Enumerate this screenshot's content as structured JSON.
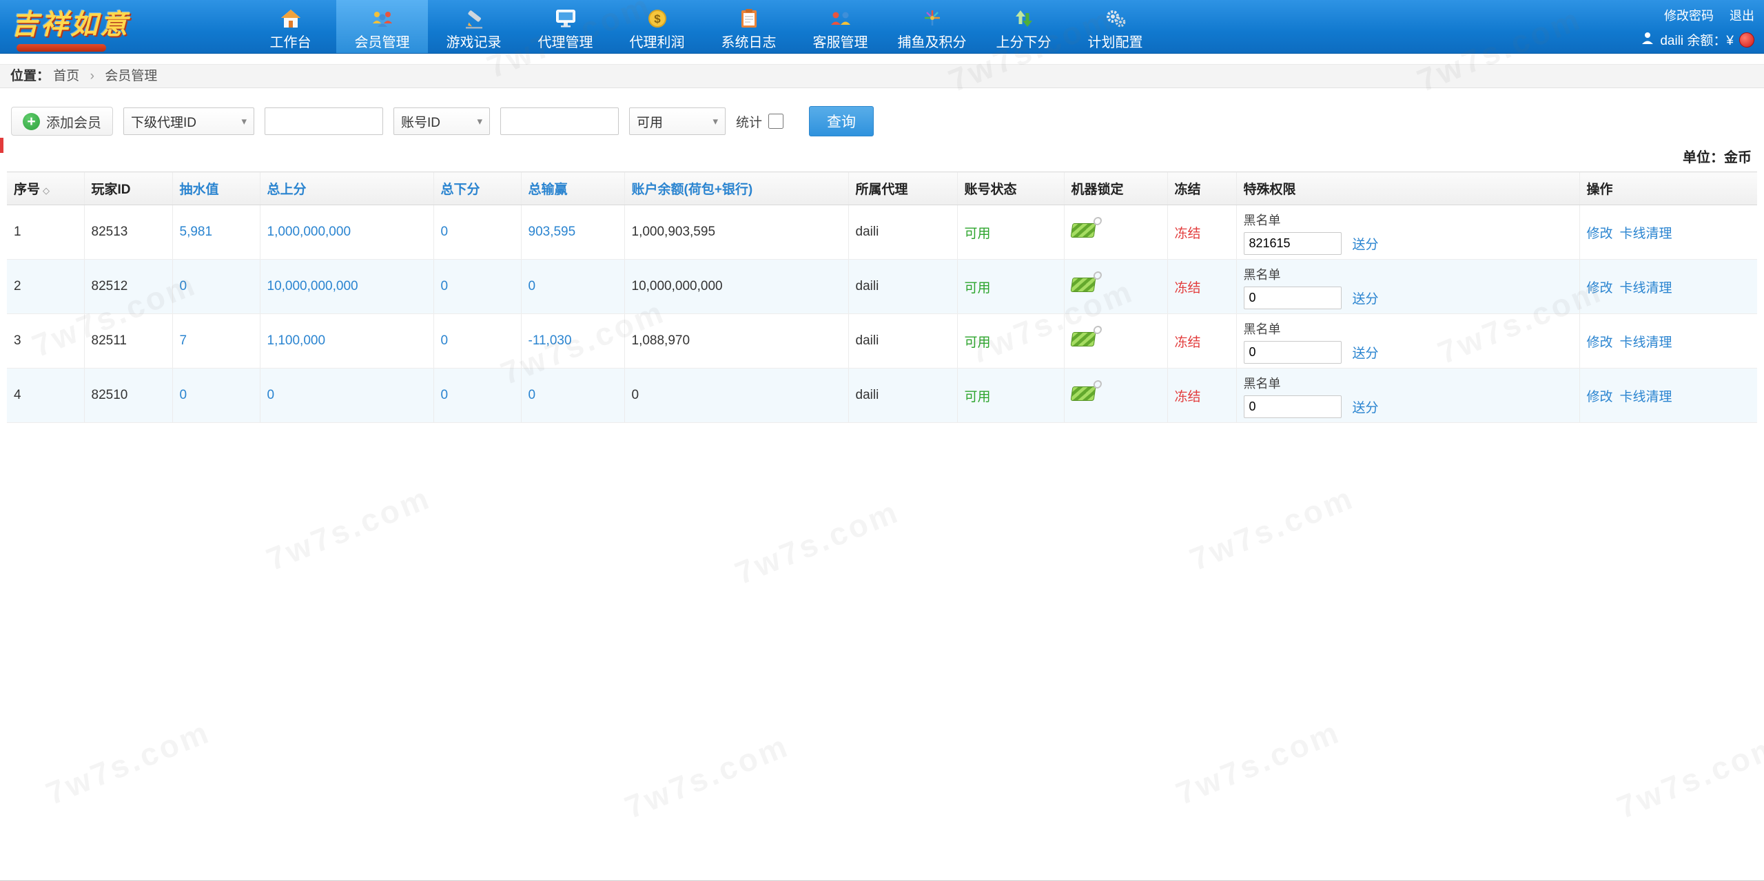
{
  "watermark": "7w7s.com",
  "navbar": {
    "logo": "吉祥如意",
    "items": [
      {
        "label": "工作台"
      },
      {
        "label": "会员管理"
      },
      {
        "label": "游戏记录"
      },
      {
        "label": "代理管理"
      },
      {
        "label": "代理利润"
      },
      {
        "label": "系统日志"
      },
      {
        "label": "客服管理"
      },
      {
        "label": "捕鱼及积分"
      },
      {
        "label": "上分下分"
      },
      {
        "label": "计划配置"
      }
    ],
    "change_password": "修改密码",
    "logout": "退出",
    "user_text": "daili 余额：¥"
  },
  "breadcrumb": {
    "prefix": "位置：",
    "home": "首页",
    "separator": "›",
    "current": "会员管理"
  },
  "toolbar": {
    "add_member": "添加会员",
    "agent_select": "下级代理ID",
    "account_select": "账号ID",
    "status_select": "可用",
    "stat_label": "统计",
    "search": "查询"
  },
  "unit_label": "单位：金币",
  "table": {
    "headers": [
      "序号",
      "玩家ID",
      "抽水值",
      "总上分",
      "总下分",
      "总输赢",
      "账户余额(荷包+银行)",
      "所属代理",
      "账号状态",
      "机器锁定",
      "冻结",
      "特殊权限",
      "操作"
    ],
    "sort_icon": "◇",
    "status_text": "可用",
    "freeze_text": "冻结",
    "blacklist_label": "黑名单",
    "send_score": "送分",
    "op_edit": "修改",
    "op_clear": "卡线清理",
    "rows": [
      {
        "index": "1",
        "player_id": "82513",
        "rake": "5,981",
        "total_up": "1,000,000,000",
        "total_down": "0",
        "win_loss": "903,595",
        "balance": "1,000,903,595",
        "agent": "daili",
        "blacklist_value": "821615"
      },
      {
        "index": "2",
        "player_id": "82512",
        "rake": "0",
        "total_up": "10,000,000,000",
        "total_down": "0",
        "win_loss": "0",
        "balance": "10,000,000,000",
        "agent": "daili",
        "blacklist_value": "0"
      },
      {
        "index": "3",
        "player_id": "82511",
        "rake": "7",
        "total_up": "1,100,000",
        "total_down": "0",
        "win_loss": "-11,030",
        "balance": "1,088,970",
        "agent": "daili",
        "blacklist_value": "0"
      },
      {
        "index": "4",
        "player_id": "82510",
        "rake": "0",
        "total_up": "0",
        "total_down": "0",
        "win_loss": "0",
        "balance": "0",
        "agent": "daili",
        "blacklist_value": "0"
      }
    ]
  }
}
